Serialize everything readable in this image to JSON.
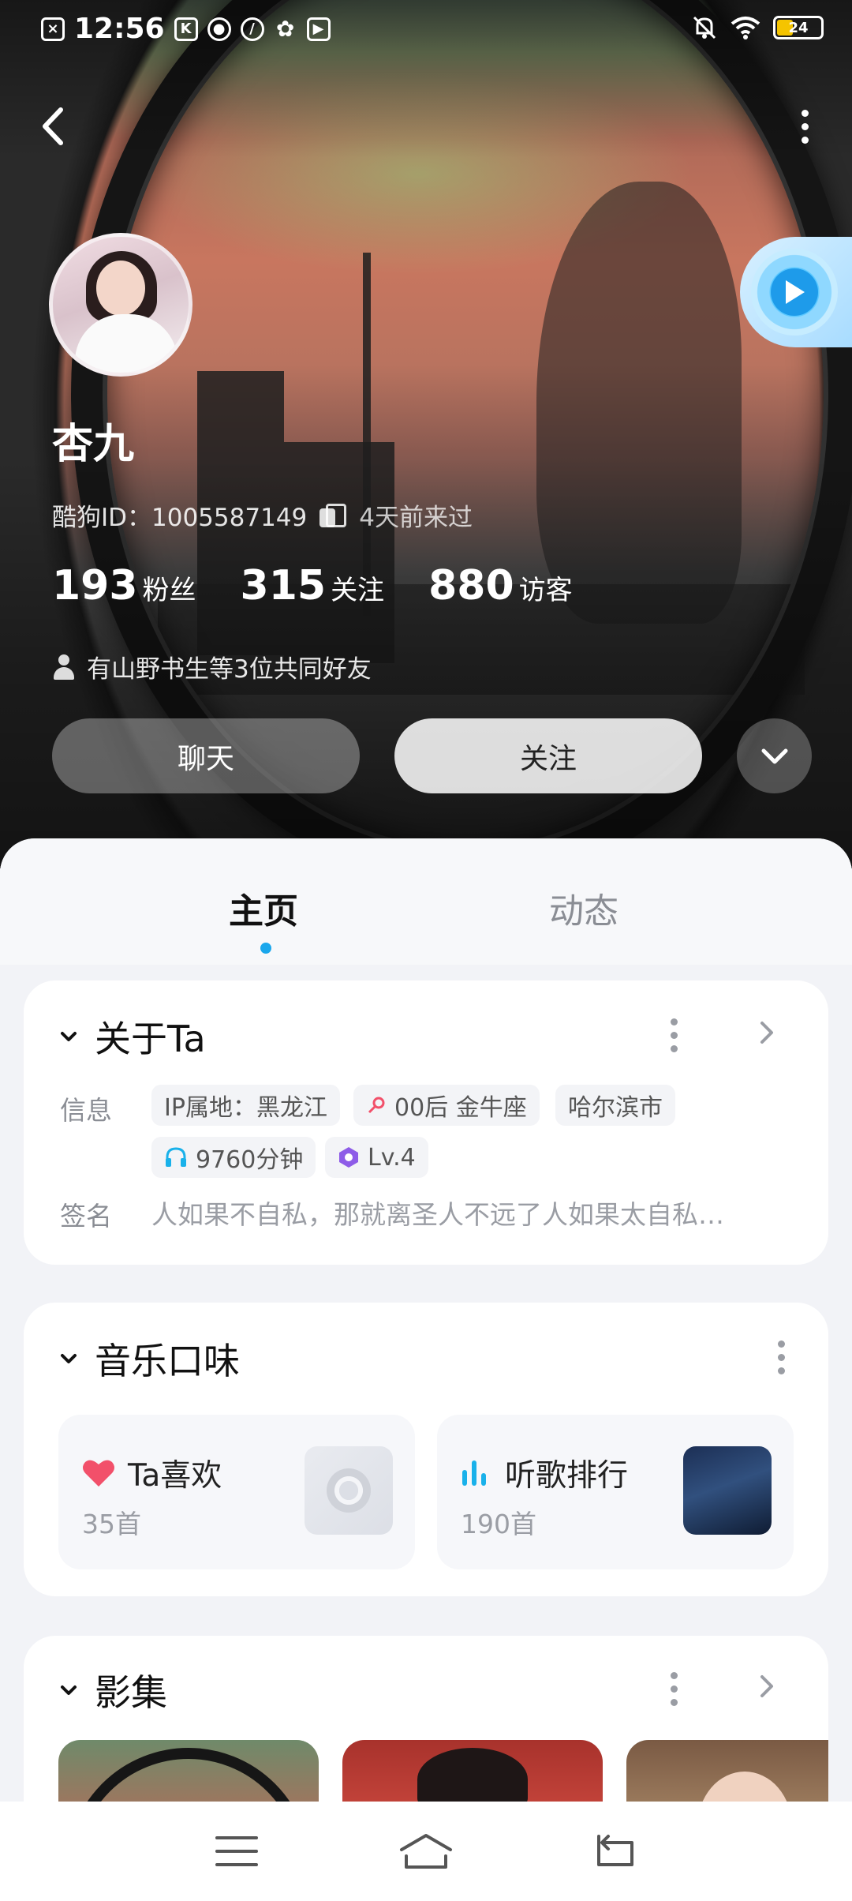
{
  "status_bar": {
    "time": "12:56",
    "battery": "24",
    "left_icons": [
      "sim-icon",
      "k-app-icon",
      "cloud-icon",
      "leaf-icon",
      "tiger-icon",
      "play-store-icon"
    ],
    "right_icons": [
      "mute-icon",
      "wifi-icon",
      "battery-icon"
    ]
  },
  "profile": {
    "name": "杏九",
    "id_line": "酷狗ID：1005587149",
    "last_seen": "4天前来过",
    "stats": [
      {
        "num": "193",
        "label": "粉丝"
      },
      {
        "num": "315",
        "label": "关注"
      },
      {
        "num": "880",
        "label": "访客"
      }
    ],
    "mutual_friends": "有山野书生等3位共同好友",
    "chat_label": "聊天",
    "follow_label": "关注"
  },
  "tabs": [
    {
      "label": "主页",
      "active": true
    },
    {
      "label": "动态",
      "active": false
    }
  ],
  "about": {
    "title": "关于Ta",
    "info_label": "信息",
    "chips": [
      "IP属地：黑龙江",
      "00后 金牛座",
      "哈尔滨市",
      "9760分钟",
      "Lv.4"
    ],
    "signature_label": "签名",
    "signature": "人如果不自私，那就离圣人不远了人如果太自私…"
  },
  "music": {
    "title": "音乐口味",
    "cards": [
      {
        "title": "Ta喜欢",
        "count": "35首",
        "icon": "heart-icon"
      },
      {
        "title": "听歌排行",
        "count": "190首",
        "icon": "bars-icon"
      }
    ]
  },
  "films": {
    "title": "影集"
  },
  "colors": {
    "accent": "#1aa7ec",
    "heart": "#f2506a",
    "bars": "#19b1ea",
    "level": "#8e5ce8"
  }
}
